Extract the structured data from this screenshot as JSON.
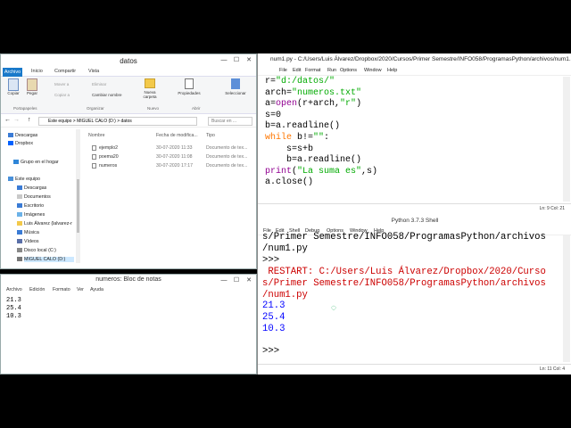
{
  "explorer": {
    "title": "datos",
    "tabs": [
      "Archivo",
      "Inicio",
      "Compartir",
      "Vista"
    ],
    "ribbon": {
      "copy": "Copiar",
      "paste": "Pegar",
      "move_to": "Mover a",
      "copy_to": "Copiar a",
      "delete": "Eliminar",
      "rename": "Cambiar nombre",
      "new_folder": "Nueva carpeta",
      "properties": "Propiedades",
      "select": "Seleccionar",
      "group_clipboard": "Portapapeles",
      "group_organize": "Organizar",
      "group_new": "Nuevo",
      "group_open": "Abrir"
    },
    "address": "Este equipo > MIGUEL CALO (D:) > datos",
    "search_placeholder": "Buscar en ...",
    "nav": [
      "Descargas",
      "Dropbox",
      "Grupo en el hogar",
      "Este equipo",
      "Descargas",
      "Documentos",
      "Escritorio",
      "Imágenes",
      "Luis Álvarez (lalvarez-r",
      "Música",
      "Vídeos",
      "Disco local (C:)",
      "MIGUEL CALO (D:)"
    ],
    "columns": [
      "Nombre",
      "Fecha de modifica...",
      "Tipo"
    ],
    "files": [
      {
        "name": "ejemplo2",
        "date": "30-07-2020 11:33",
        "type": "Documento de tex..."
      },
      {
        "name": "poema20",
        "date": "30-07-2020 11:08",
        "type": "Documento de tex..."
      },
      {
        "name": "numeros",
        "date": "30-07-2020 17:17",
        "type": "Documento de tex..."
      }
    ]
  },
  "notepad": {
    "title": "numeros: Bloc de notas",
    "menu": [
      "Archivo",
      "Edición",
      "Formato",
      "Ver",
      "Ayuda"
    ],
    "content": "21.3\n25.4\n10.3"
  },
  "editor": {
    "title": "num1.py - C:/Users/Luis Álvarez/Dropbox/2020/Cursos/Primer Semestre/INFO058/ProgramasPython/archivos/num1.py (3.7.3)",
    "menu": [
      "File",
      "Edit",
      "Format",
      "Run",
      "Options",
      "Window",
      "Help"
    ],
    "code": {
      "l1a": "r=",
      "l1s": "\"d:/datos/\"",
      "l2a": "arch=",
      "l2s": "\"numeros.txt\"",
      "l3a": "a=",
      "l3b": "open",
      "l3c": "(r+arch,",
      "l3s": "\"r\"",
      "l3d": ")",
      "l4": "s=0",
      "l5": "b=a.readline()",
      "l6k": "while",
      "l6a": " b!=",
      "l6s": "\"\"",
      "l6b": ":",
      "l7": "    s=s+b",
      "l8": "    b=a.readline()",
      "l9b": "print",
      "l9a": "(",
      "l9s": "\"La suma es\"",
      "l9c": ",s)",
      "l10": "a.close()"
    },
    "status": "Ln: 9   Col: 21"
  },
  "shell": {
    "title": "Python 3.7.3 Shell",
    "menu": [
      "File",
      "Edit",
      "Shell",
      "Debug",
      "Options",
      "Window",
      "Help"
    ],
    "line1": "s/Primer Semestre/INFO058/ProgramasPython/archivos",
    "line2": "/num1.py",
    "prompt1": ">>> ",
    "restart1": " RESTART: C:/Users/Luis Álvarez/Dropbox/2020/Curso",
    "restart2": "s/Primer Semestre/INFO058/ProgramasPython/archivos",
    "restart3": "/num1.py",
    "out1": "21.3",
    "out2": "25.4",
    "out3": "10.3",
    "prompt2": ">>> ",
    "status": "Ln: 11   Col: 4"
  }
}
